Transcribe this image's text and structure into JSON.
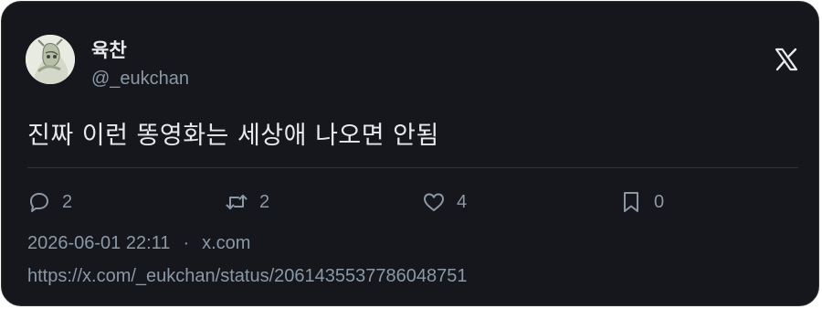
{
  "author": {
    "display_name": "육찬",
    "handle": "@_eukchan"
  },
  "logo": {
    "icon": "x-logo-icon",
    "label": "𝕏"
  },
  "tweet": {
    "text": "진짜 이런 똥영화는 세상애 나오면 안됨"
  },
  "actions": {
    "replies": "2",
    "retweets": "2",
    "likes": "4",
    "bookmarks": "0"
  },
  "meta": {
    "timestamp": "2026-06-01 22:11",
    "separator": "·",
    "source": "x.com",
    "url": "https://x.com/_eukchan/status/2061435537786048751"
  },
  "colors": {
    "background": "#15171c",
    "text": "#e7e9ea",
    "muted": "#8b98a5",
    "border": "#2f3336"
  }
}
